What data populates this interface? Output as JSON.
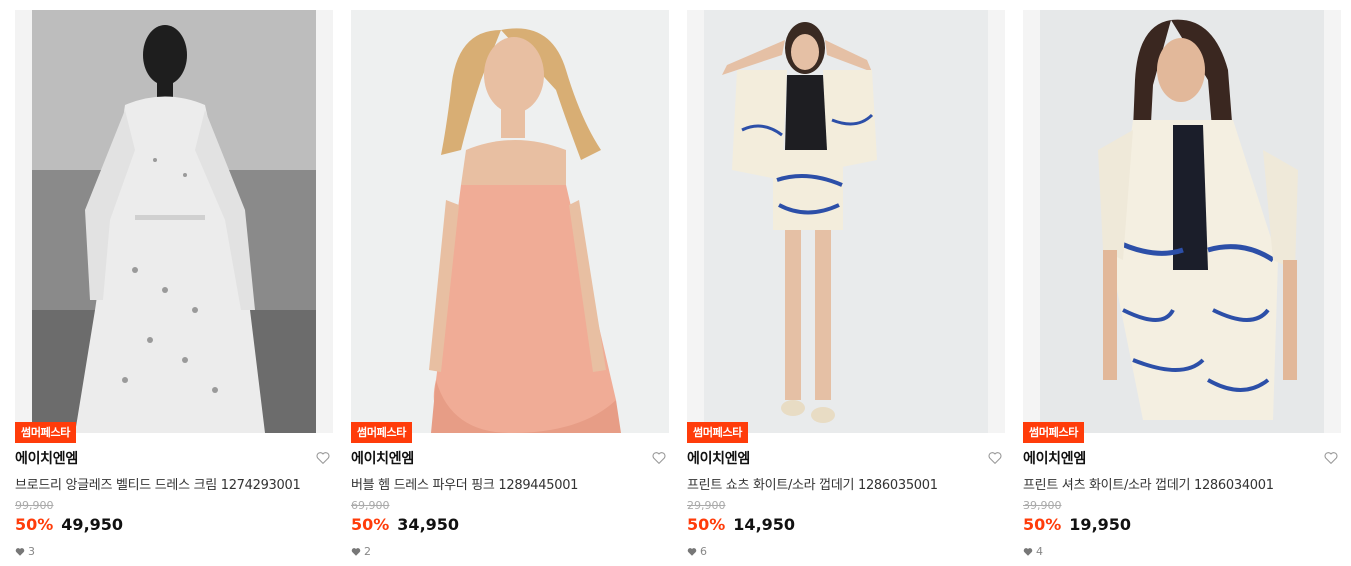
{
  "products": [
    {
      "badge": "썸머페스타",
      "brand": "에이치엔엠",
      "name": "브로드리 앙글레즈 벨티드 드레스 크림 1274293001",
      "original_price": "99,900",
      "discount": "50%",
      "price": "49,950",
      "likes": "3",
      "image_icon": "photo-model-white-eyelet-dress"
    },
    {
      "badge": "썸머페스타",
      "brand": "에이치엔엠",
      "name": "버블 헴 드레스 파우더 핑크 1289445001",
      "original_price": "69,900",
      "discount": "50%",
      "price": "34,950",
      "likes": "2",
      "image_icon": "photo-model-pink-bubble-dress"
    },
    {
      "badge": "썸머페스타",
      "brand": "에이치엔엠",
      "name": "프린트 쇼츠 화이트/소라 껍데기 1286035001",
      "original_price": "29,900",
      "discount": "50%",
      "price": "14,950",
      "likes": "6",
      "image_icon": "photo-model-printed-shorts"
    },
    {
      "badge": "썸머페스타",
      "brand": "에이치엔엠",
      "name": "프린트 셔츠 화이트/소라 껍데기 1286034001",
      "original_price": "39,900",
      "discount": "50%",
      "price": "19,950",
      "likes": "4",
      "image_icon": "photo-model-printed-shirt"
    }
  ],
  "colors": {
    "accent": "#ff3c0a",
    "strike": "#aaaaaa"
  }
}
